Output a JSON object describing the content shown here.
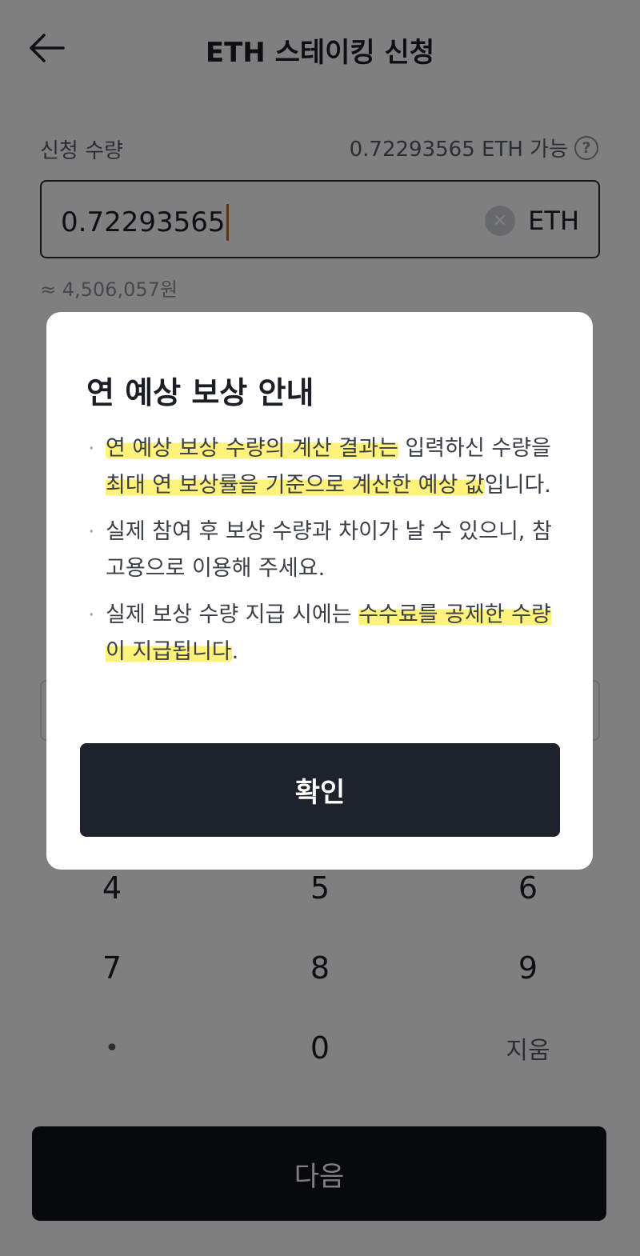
{
  "header": {
    "title": "ETH 스테이킹 신청",
    "back_icon": "arrow-left-icon"
  },
  "amount": {
    "label": "신청 수량",
    "available": "0.72293565 ETH 가능",
    "help_icon_glyph": "?",
    "value": "0.72293565",
    "clear_icon_glyph": "✕",
    "unit": "ETH",
    "krw_estimate": "≈ 4,506,057원"
  },
  "keypad": {
    "keys": [
      "4",
      "5",
      "6",
      "7",
      "8",
      "9",
      "•",
      "0",
      "지움"
    ]
  },
  "next_button": {
    "label": "다음"
  },
  "dialog": {
    "title": "연 예상 보상 안내",
    "bullet1": {
      "hl1": "연 예상 보상 수량의 계산 결과는",
      "t1": " 입력하신 수량을",
      "hl2": " 최대 연 보상률을 기준으로 계산한 예상 값",
      "t2": "입니다."
    },
    "bullet2": {
      "text": "실제 참여 후 보상 수량과 차이가 날 수 있으니, 참고용으로 이용해 주세요."
    },
    "bullet3": {
      "t1": "실제 보상 수량 지급 시에는 ",
      "hl1": "수수료를 공제한 수량이 지급됩니다",
      "t2": "."
    },
    "confirm_label": "확인"
  },
  "colors": {
    "highlight": "#fff27a",
    "dark_button": "#1e222c",
    "caret": "#b86b1e"
  }
}
